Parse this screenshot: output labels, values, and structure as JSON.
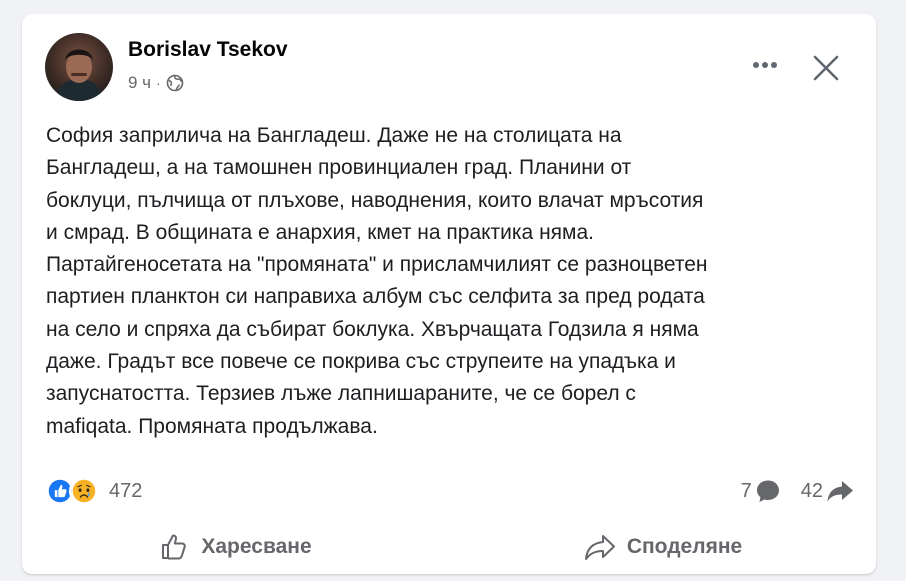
{
  "post": {
    "author": "Borislav Tsekov",
    "time": "9 ч",
    "meta_separator": "·",
    "privacy_icon": "globe-icon",
    "body": "София заприлича на Бангладеш. Даже не на столицата на\nБангладеш, а на тамошнен провинциален град. Планини от\nбоклуци, пълчища от плъхове, наводнения, които влачат мръсотия\nи смрад. В общината е анархия, кмет на практика няма.\nПартайгеносетата на \"промяната\" и присламчилият се разноцветен\nпартиен планктон си направиха албум със селфита за пред родата\nна село и спряха да събират боклука. Хвърчащата Годзила я няма\nдаже. Градът все повече се покрива със струпеите на упадъка и\nзапуснатостта. Терзиев лъже лапнишараните, че се борел с\nmafiqata. Промяната продължава."
  },
  "reactions": {
    "icons": [
      "like-icon",
      "sad-icon"
    ],
    "count": "472"
  },
  "stats": {
    "comments": "7",
    "shares": "42"
  },
  "actions": {
    "like_label": "Харесване",
    "share_label": "Споделяне"
  },
  "colors": {
    "background": "#f0f2f5",
    "card": "#ffffff",
    "like_blue": "#1877f2",
    "sad_yellow": "#f7b125",
    "secondary_text": "#65676b"
  }
}
